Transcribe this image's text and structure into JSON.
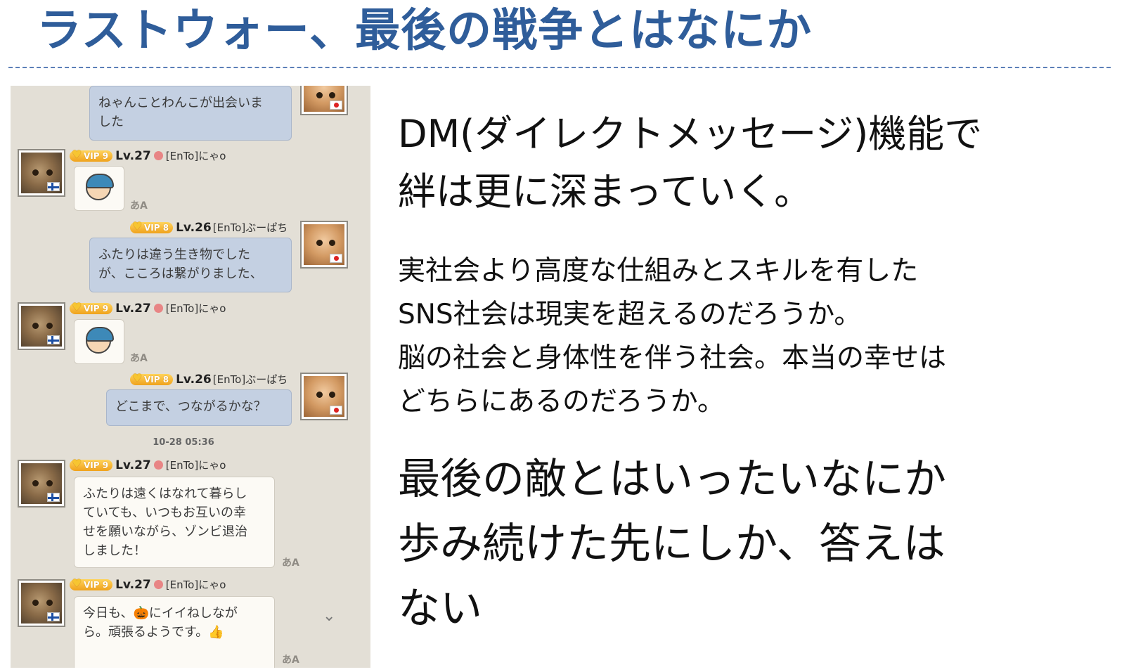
{
  "slide": {
    "title": "ラストウォー、最後の戦争とはなにか",
    "paragraph1": "DM(ダイレクトメッセージ)機能で\n絆は更に深まっていく。",
    "paragraph2": "実社会より高度な仕組みとスキルを有した\nSNS社会は現実を超えるのだろうか。\n脳の社会と身体性を伴う社会。本当の幸せは\nどちらにあるのだろうか。",
    "paragraph3": "最後の敵とはいったいなにか\n歩み続けた先にしか、答えは\nない"
  },
  "chat": {
    "users": {
      "cat": {
        "vip": "VIP 9",
        "level": "Lv.27",
        "name": "[EnTo]にゃo"
      },
      "dog": {
        "vip": "VIP 8",
        "level": "Lv.26",
        "name": "[EnTo]ぶーぱち"
      }
    },
    "messages": [
      {
        "text": "ねゃんことわんこが出会いま\nした"
      },
      {
        "text": "ふたりは違う生き物でした\nが、こころは繋がりました、"
      },
      {
        "text": "どこまで、つながるかな？"
      },
      {
        "text": "ふたりは遠くはなれて暮らし\nていても、いつもお互いの幸\nせを願いながら、ゾンビ退治\nしました！"
      },
      {
        "text": "今日も、🎃にイイねしなが\nら。頑張るようです。👍"
      }
    ],
    "timestamp": "10-28 05:36",
    "translate_glyph": "あA",
    "scroll_glyph": "⌄"
  },
  "colors": {
    "title": "#2f5d9a",
    "self_bubble": "#c4d0e2",
    "other_bubble": "#fcfaf5",
    "chat_bg": "#e3dfd6"
  }
}
